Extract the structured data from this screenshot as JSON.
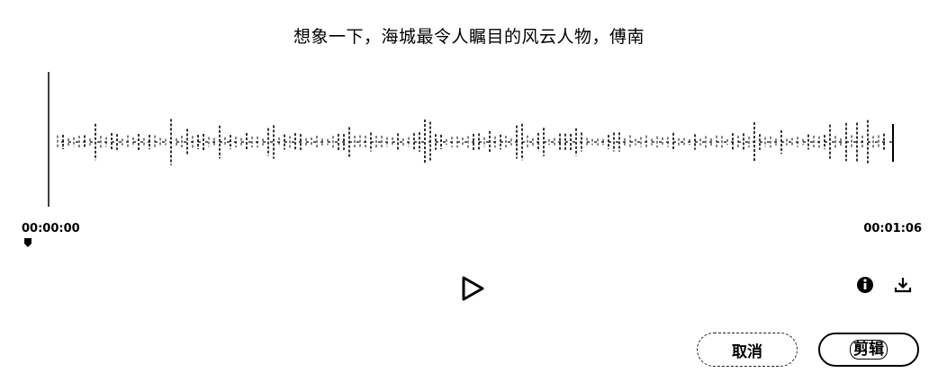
{
  "title": "想象一下，海城最令人瞩目的风云人物，傅南",
  "timeline": {
    "start_time": "00:00:00",
    "end_time": "00:01:06"
  },
  "icons": {
    "play": "play-icon",
    "info": "info-icon",
    "download": "download-icon",
    "marker": "playhead-marker-icon"
  },
  "buttons": {
    "cancel_label": "取消",
    "cut_label": "剪辑"
  }
}
